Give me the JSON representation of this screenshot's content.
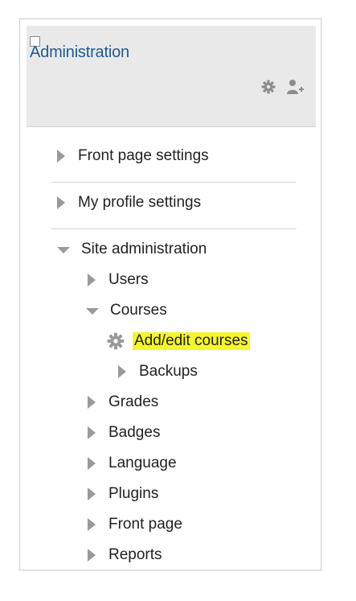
{
  "header": {
    "title": "Administration",
    "icons": [
      "block-icon",
      "gear-icon",
      "user-add-icon"
    ]
  },
  "nav": {
    "front_page_settings": "Front page settings",
    "my_profile_settings": "My profile settings",
    "site_administration": "Site administration",
    "users": "Users",
    "courses": "Courses",
    "add_edit_courses": "Add/edit courses",
    "backups": "Backups",
    "grades": "Grades",
    "badges": "Badges",
    "language": "Language",
    "plugins": "Plugins",
    "front_page": "Front page",
    "reports": "Reports"
  },
  "colors": {
    "title": "#1f5a94",
    "highlight": "#f6f62e",
    "triangle": "#9a9a9a",
    "header_bg": "#e9e9e9"
  }
}
